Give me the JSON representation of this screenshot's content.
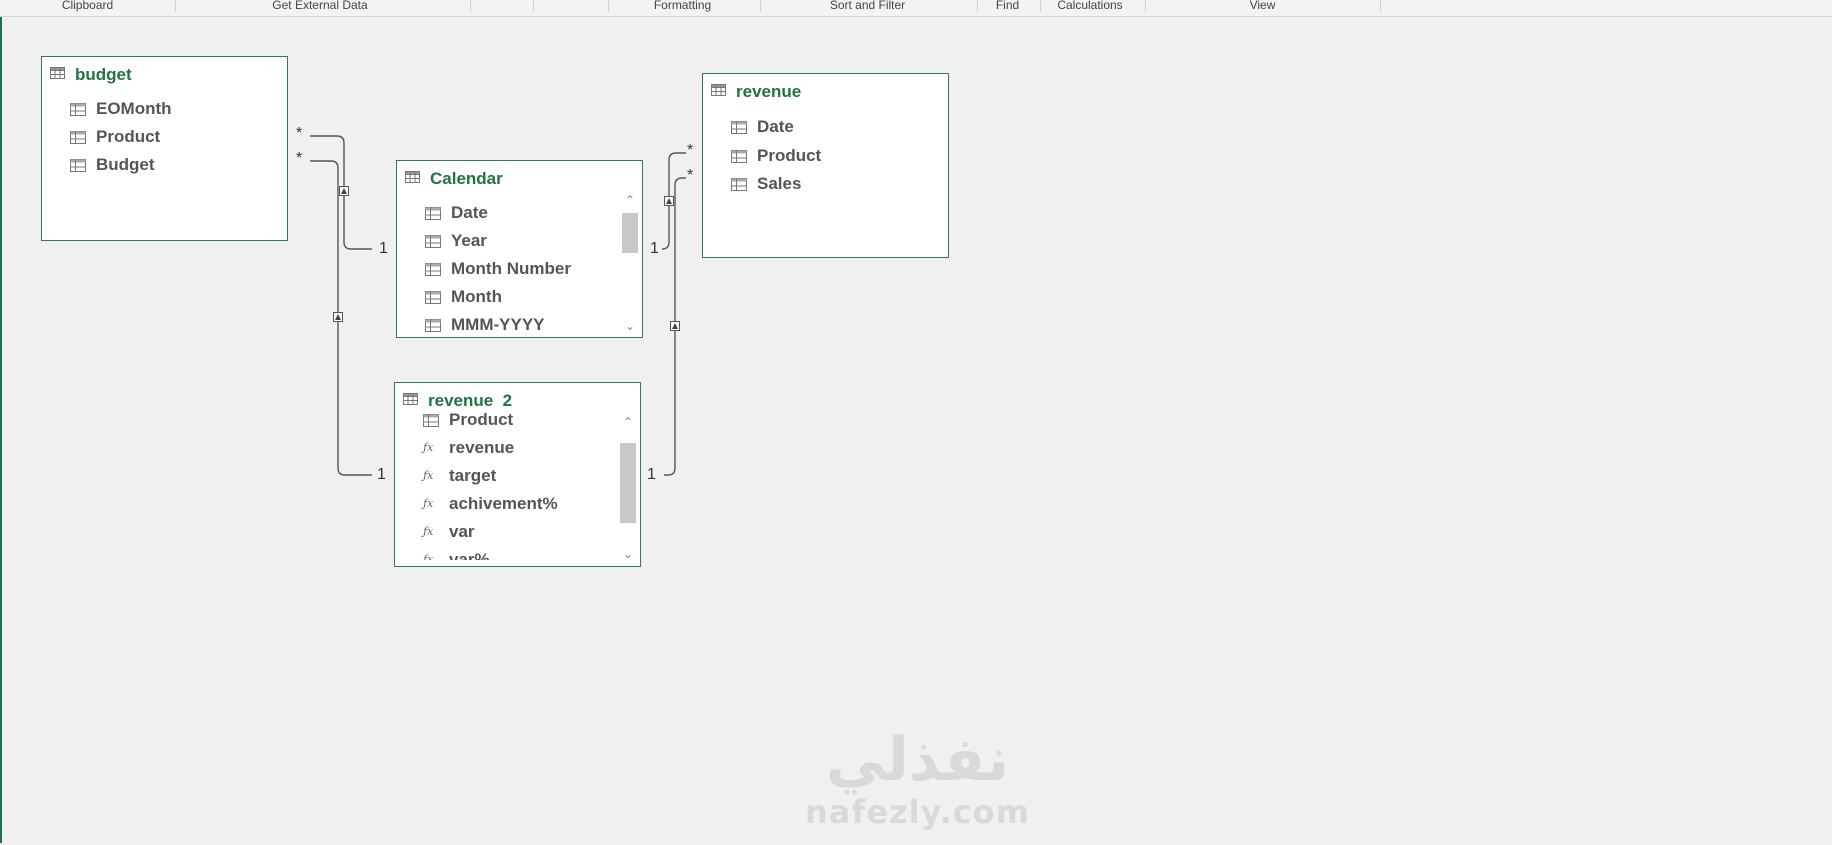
{
  "ribbon": {
    "groups": [
      "Clipboard",
      "Get External Data",
      "Formatting",
      "Sort and Filter",
      "Find",
      "Calculations",
      "View"
    ]
  },
  "tables": {
    "budget": {
      "title": "budget",
      "fields": [
        "EOMonth",
        "Product",
        "Budget"
      ]
    },
    "calendar": {
      "title": "Calendar",
      "fields": [
        "Date",
        "Year",
        "Month Number",
        "Month",
        "MMM-YYYY"
      ]
    },
    "revenue": {
      "title": "revenue",
      "fields": [
        "Date",
        "Product",
        "Sales"
      ]
    },
    "revenue2": {
      "title": "revenue  2",
      "fields": [
        {
          "label": "Product",
          "type": "column"
        },
        {
          "label": "revenue",
          "type": "measure"
        },
        {
          "label": "target",
          "type": "measure"
        },
        {
          "label": "achivement%",
          "type": "measure"
        },
        {
          "label": "var",
          "type": "measure"
        },
        {
          "label": "var%",
          "type": "measure"
        }
      ]
    }
  },
  "relationships": {
    "many": "*",
    "one": "1"
  },
  "icons": {
    "table": "table-grid-icon",
    "column": "column-icon",
    "measure": "fx-measure-icon",
    "scroll_up": "chevron-up-icon",
    "scroll_down": "chevron-down-icon"
  },
  "watermark": {
    "arabic": "نفذلي",
    "latin": "nafezly.com"
  },
  "colors": {
    "accent": "#217346",
    "border": "#2e7d4f",
    "canvas": "#f0f0f0",
    "field_text": "#555555",
    "watermark": "#d9d9d9"
  }
}
